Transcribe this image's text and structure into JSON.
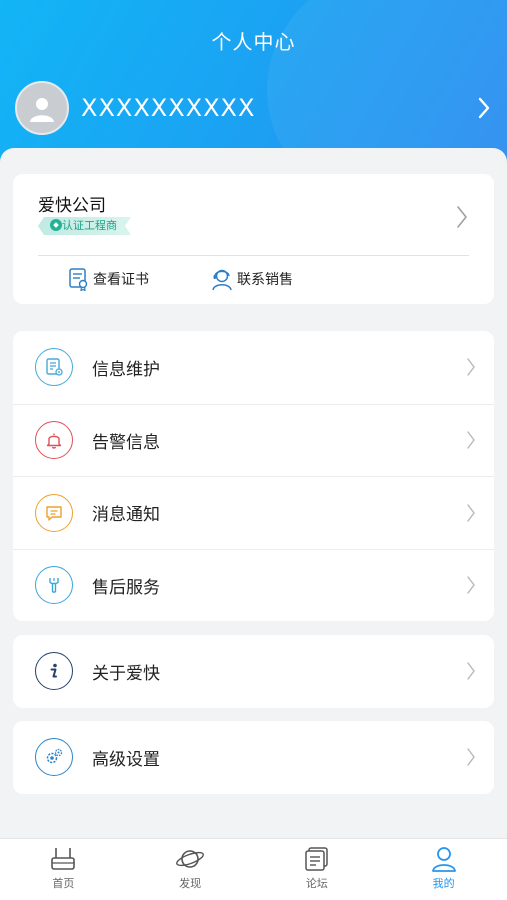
{
  "header": {
    "title": "个人中心",
    "username": "XXXXXXXXXX",
    "avatar_icon": "user-avatar-icon"
  },
  "company": {
    "name": "爱快公司",
    "badge": "认证工程商",
    "actions": [
      {
        "label": "查看证书",
        "icon": "certificate-icon"
      },
      {
        "label": "联系销售",
        "icon": "sales-contact-icon"
      }
    ]
  },
  "menu_group_1": [
    {
      "label": "信息维护",
      "icon": "info-edit-icon",
      "color": "#4aa9d8"
    },
    {
      "label": "告警信息",
      "icon": "bell-icon",
      "color": "#e0505a"
    },
    {
      "label": "消息通知",
      "icon": "message-icon",
      "color": "#f0a030"
    },
    {
      "label": "售后服务",
      "icon": "wrench-icon",
      "color": "#3ba6d8"
    }
  ],
  "menu_group_2": [
    {
      "label": "关于爱快",
      "icon": "info-icon",
      "color": "#27406e"
    }
  ],
  "menu_group_3": [
    {
      "label": "高级设置",
      "icon": "gears-icon",
      "color": "#2f86c8"
    }
  ],
  "tabbar": [
    {
      "label": "首页",
      "icon": "router-icon",
      "active": false
    },
    {
      "label": "发现",
      "icon": "planet-icon",
      "active": false
    },
    {
      "label": "论坛",
      "icon": "forum-icon",
      "active": false
    },
    {
      "label": "我的",
      "icon": "person-icon",
      "active": true
    }
  ],
  "colors": {
    "header_start": "#12b5f6",
    "header_end": "#2a8cf0",
    "active_tab": "#2496f0",
    "badge_green": "#23b394"
  }
}
